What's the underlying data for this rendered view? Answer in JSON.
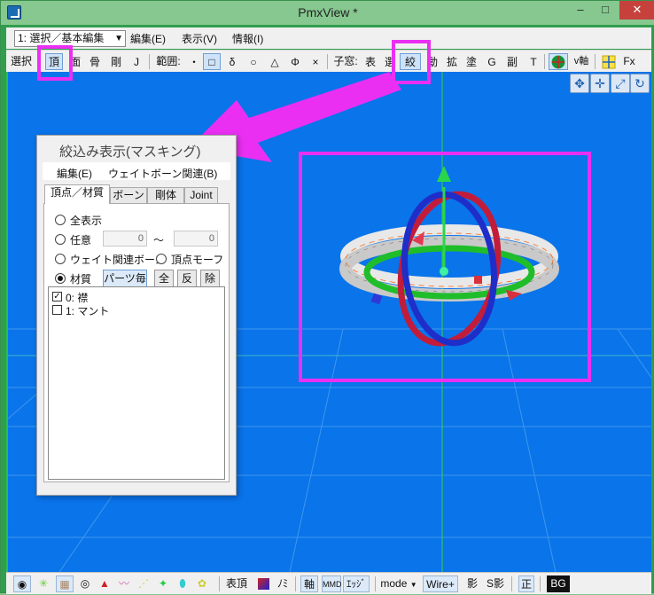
{
  "window": {
    "title": "PmxView *",
    "min": "–",
    "max": "□",
    "close": "✕"
  },
  "menubar": {
    "mode": "1: 選択／基本編集",
    "edit": "編集(E)",
    "view": "表示(V)",
    "info": "情報(I)"
  },
  "toolbar": {
    "select": "選択",
    "vertex": "頂",
    "face": "面",
    "bone": "骨",
    "rigid": "剛",
    "joint": "J",
    "range": "範囲:",
    "r_dot": "・",
    "r_rect": "□",
    "r_delta": "δ",
    "r_circle": "○",
    "r_tri": "△",
    "r_phi": "Φ",
    "r_x": "×",
    "child": "子窓:",
    "c_table": "表",
    "c_sel": "選",
    "c_mask": "絞",
    "c_move": "動",
    "c_scale": "拡",
    "c_paint": "塗",
    "c_g": "G",
    "c_sub": "副",
    "c_t": "T",
    "v_axis": "v軸",
    "fx": "Fx"
  },
  "mask_panel": {
    "title": "絞込み表示(マスキング)",
    "menu_edit": "編集(E)",
    "menu_weight": "ウェイトボーン関連(B)",
    "tabs": [
      "頂点／材質",
      "ボーン",
      "剛体",
      "Joint"
    ],
    "opt_all": "全表示",
    "opt_any": "任意",
    "any_from": "0",
    "tilde": "～",
    "any_to": "0",
    "opt_weight": "ウェイト関連ボーン",
    "opt_vmorph": "頂点モーフ",
    "opt_material": "材質",
    "btn_parts": "パーツ毎",
    "btn_all": "全",
    "btn_inv": "反",
    "btn_del": "除",
    "materials": [
      {
        "label": "0: 襟",
        "checked": true
      },
      {
        "label": "1: マント",
        "checked": false
      }
    ]
  },
  "statusbar": {
    "vertex_table": "表頂",
    "no": "ﾉﾐ",
    "axis": "軸",
    "mmd": "MMD",
    "edge": "ｴｯｼﾞ",
    "mode": "mode",
    "wire": "Wire+",
    "shadow": "影",
    "sshadow": "S影",
    "front": "正",
    "bg": "BG"
  },
  "colors": {
    "viewport": "#0a74ea",
    "highlight": "#ea2ff2",
    "titlebar": "#86c88f"
  }
}
